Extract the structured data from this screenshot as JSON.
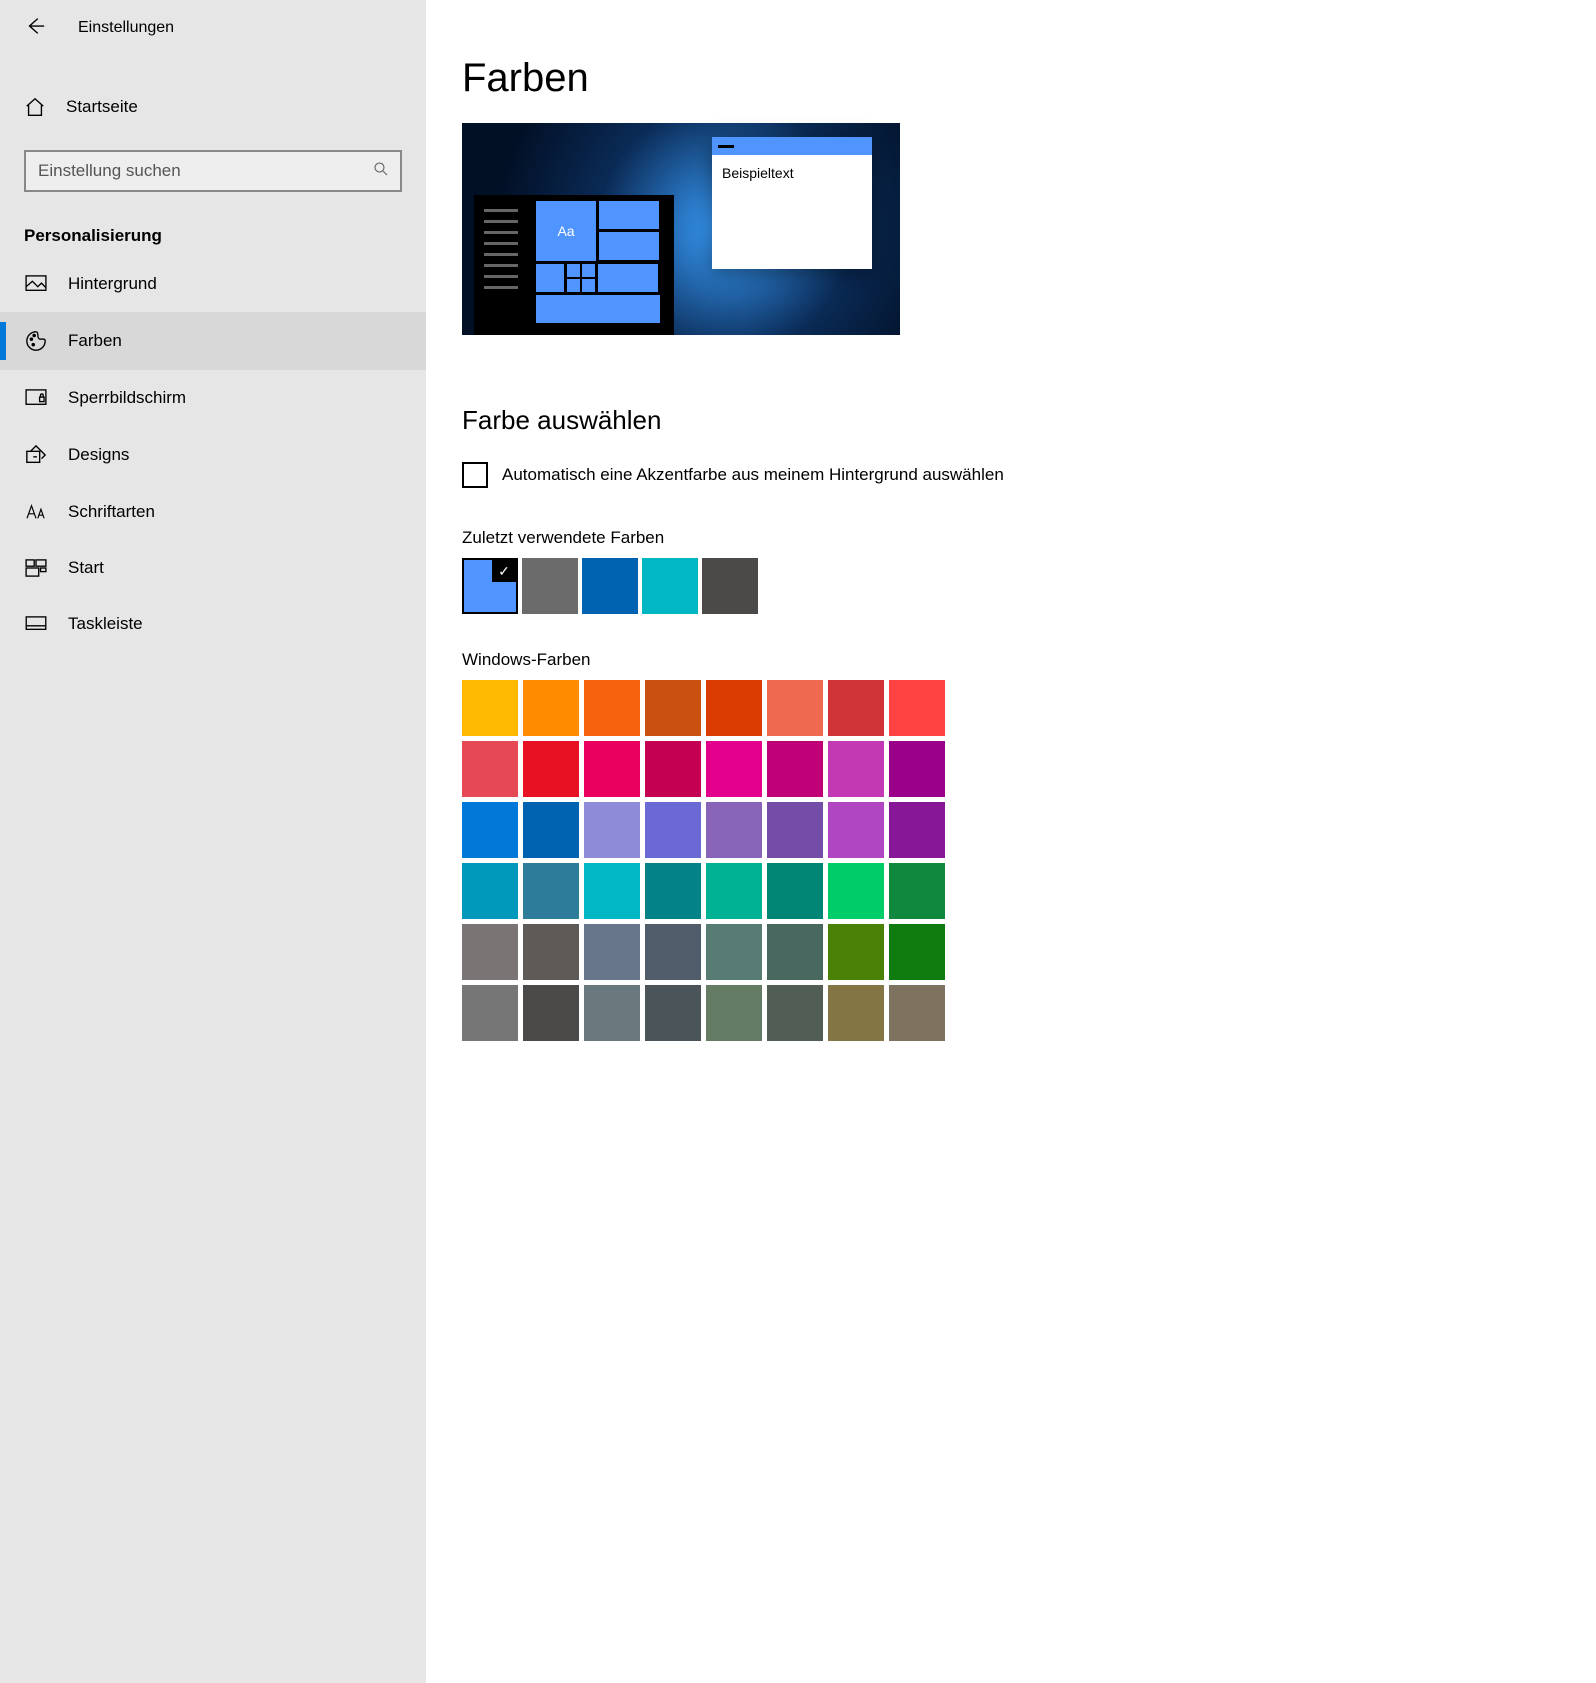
{
  "app_title": "Einstellungen",
  "home_label": "Startseite",
  "search": {
    "placeholder": "Einstellung suchen"
  },
  "section_title": "Personalisierung",
  "nav": [
    {
      "id": "background",
      "label": "Hintergrund",
      "active": false
    },
    {
      "id": "colors",
      "label": "Farben",
      "active": true
    },
    {
      "id": "lockscreen",
      "label": "Sperrbildschirm",
      "active": false
    },
    {
      "id": "themes",
      "label": "Designs",
      "active": false
    },
    {
      "id": "fonts",
      "label": "Schriftarten",
      "active": false
    },
    {
      "id": "start",
      "label": "Start",
      "active": false
    },
    {
      "id": "taskbar",
      "label": "Taskleiste",
      "active": false
    }
  ],
  "page_title": "Farben",
  "preview": {
    "sample_text": "Beispieltext",
    "tile_letters": "Aa"
  },
  "choose_color_title": "Farbe auswählen",
  "auto_accent_label": "Automatisch eine Akzentfarbe aus meinem Hintergrund auswählen",
  "recent_label": "Zuletzt verwendete Farben",
  "recent_colors": [
    "#4f94ff",
    "#6b6b6b",
    "#0063b1",
    "#00b7c3",
    "#4c4a48"
  ],
  "windows_colors_label": "Windows-Farben",
  "windows_colors": [
    "#ffb900",
    "#ff8c00",
    "#f7630c",
    "#ca5010",
    "#da3b01",
    "#ef6950",
    "#d13438",
    "#ff4343",
    "#e74856",
    "#e81123",
    "#ea005e",
    "#c30052",
    "#e3008c",
    "#bf0077",
    "#c239b3",
    "#9a0089",
    "#0078d7",
    "#0063b1",
    "#8e8cd8",
    "#6b69d6",
    "#8764b8",
    "#744da9",
    "#b146c2",
    "#881798",
    "#0099bc",
    "#2d7d9a",
    "#00b7c3",
    "#038387",
    "#00b294",
    "#018574",
    "#00cc6a",
    "#10893e",
    "#7a7574",
    "#5d5a58",
    "#68768a",
    "#515c6b",
    "#567c73",
    "#486860",
    "#498205",
    "#107c10",
    "#767676",
    "#4c4a48",
    "#69797e",
    "#4a5459",
    "#647c64",
    "#525e54",
    "#847545",
    "#7e735f"
  ]
}
